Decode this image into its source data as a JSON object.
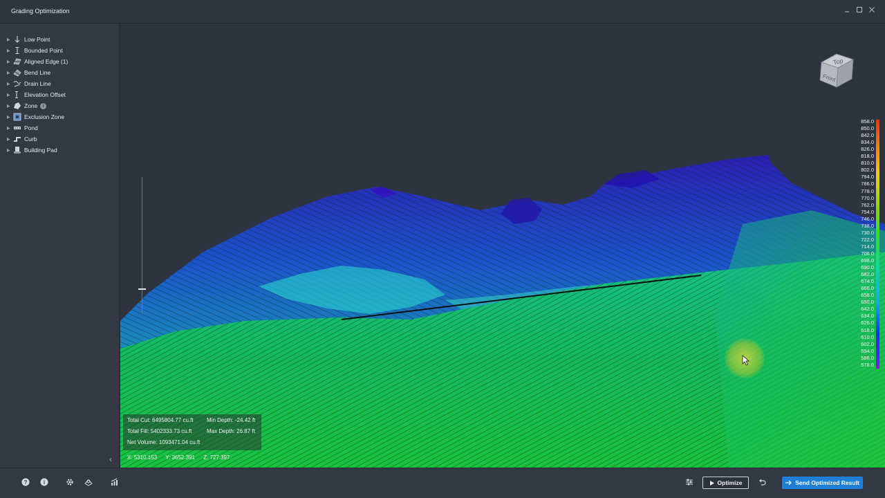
{
  "window": {
    "title": "Grading Optimization",
    "controls": [
      "minimize-icon",
      "maximize-icon",
      "close-icon"
    ]
  },
  "sidebar": {
    "items": [
      {
        "label": "Low Point",
        "icon": "low-point-icon"
      },
      {
        "label": "Bounded Point",
        "icon": "bounded-point-icon"
      },
      {
        "label": "Aligned Edge (1)",
        "icon": "aligned-edge-icon"
      },
      {
        "label": "Bend Line",
        "icon": "bend-line-icon"
      },
      {
        "label": "Drain Line",
        "icon": "drain-line-icon"
      },
      {
        "label": "Elevation Offset",
        "icon": "elevation-offset-icon"
      },
      {
        "label": "Zone",
        "icon": "zone-icon",
        "info": "i"
      },
      {
        "label": "Exclusion Zone",
        "icon": "exclusion-zone-icon"
      },
      {
        "label": "Pond",
        "icon": "pond-icon"
      },
      {
        "label": "Curb",
        "icon": "curb-icon"
      },
      {
        "label": "Building Pad",
        "icon": "building-pad-icon"
      }
    ],
    "collapse_glyph": "‹"
  },
  "viewcube": {
    "top": "Top",
    "front": "Front"
  },
  "legend": {
    "values": [
      "858.0",
      "850.0",
      "842.0",
      "834.0",
      "826.0",
      "818.0",
      "810.0",
      "802.0",
      "794.0",
      "786.0",
      "778.0",
      "770.0",
      "762.0",
      "754.0",
      "746.0",
      "738.0",
      "730.0",
      "722.0",
      "714.0",
      "706.0",
      "698.0",
      "690.0",
      "682.0",
      "674.0",
      "666.0",
      "658.0",
      "650.0",
      "642.0",
      "634.0",
      "626.0",
      "618.0",
      "610.0",
      "602.0",
      "594.0",
      "586.0",
      "578.0"
    ]
  },
  "stats": {
    "total_cut": "Total Cut: 6495804.77 cu.ft",
    "min_depth": "Min Depth: -24.42 ft",
    "total_fill": "Total Fill: 5402333.73 cu.ft",
    "max_depth": "Max Depth: 26.87 ft",
    "net_volume": "Net Volume: 1093471.04 cu.ft"
  },
  "coords": {
    "x": "X:  5310.153",
    "y": "Y:  3652.391",
    "z": "Z:  727.397"
  },
  "bottom": {
    "optimize_label": "Optimize",
    "send_label": "Send Optimized Result"
  },
  "colors": {
    "accent": "#1f7fd6",
    "panel": "#323945",
    "viewport": "#2e3340"
  }
}
